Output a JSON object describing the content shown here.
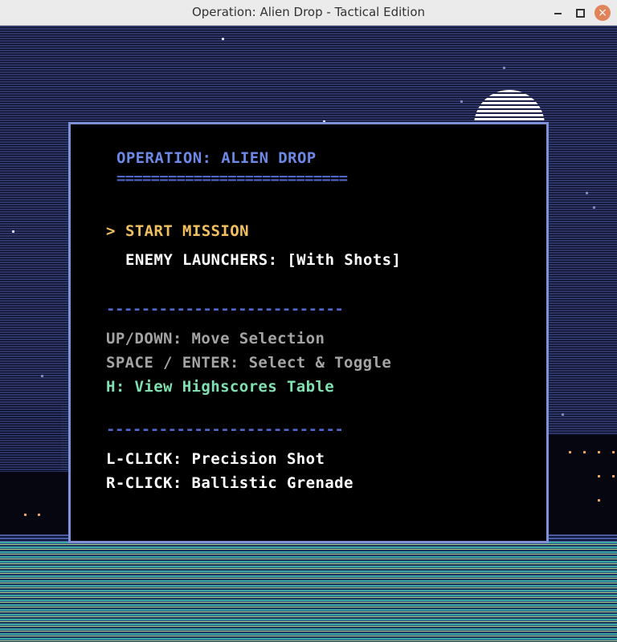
{
  "window": {
    "title": "Operation: Alien Drop - Tactical Edition",
    "controls": {
      "minimize": "–",
      "maximize": "□",
      "close": "×"
    }
  },
  "menu": {
    "heading": "OPERATION: ALIEN DROP",
    "heading_underline": "===========================",
    "cursor": ">",
    "items": [
      {
        "label": "START MISSION",
        "selected": true
      },
      {
        "label": "ENEMY LAUNCHERS: [With Shots]",
        "selected": false
      }
    ],
    "separator": "---------------------------",
    "help": [
      "UP/DOWN: Move Selection",
      "SPACE / ENTER: Select & Toggle",
      "H: View Highscores Table"
    ],
    "controls": [
      "L-CLICK: Precision Shot",
      "R-CLICK: Ballistic Grenade"
    ]
  },
  "colors": {
    "panel_border": "#7d90d8",
    "heading": "#6e88e6",
    "selected": "#f0c060",
    "option": "#ffffff",
    "help": "#a4a4a4",
    "highscores": "#80e0b0"
  }
}
